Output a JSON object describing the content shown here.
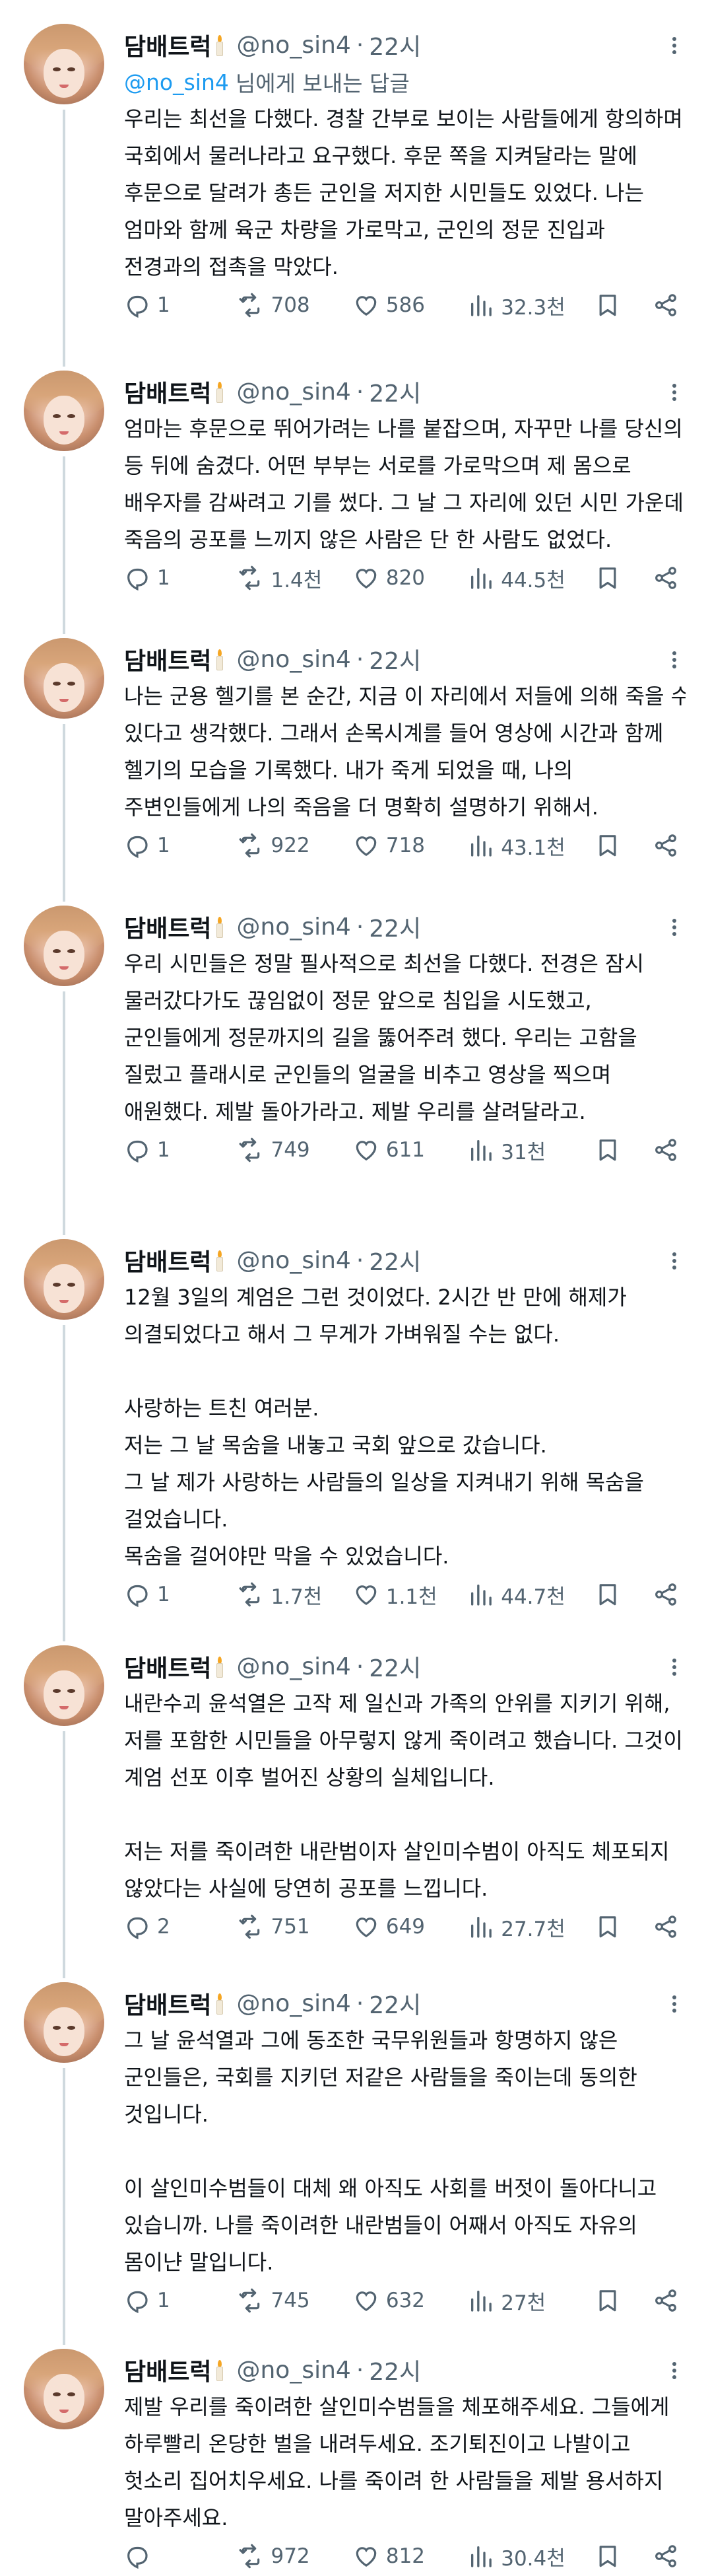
{
  "author": {
    "name": "담배트럭",
    "handle": "@no_sin4",
    "time": "22시"
  },
  "reply_prefix": {
    "mention": "@no_sin4",
    "text": "님에게 보내는 답글"
  },
  "tweets": [
    {
      "lines": [
        "우리는 최선을 다했다. 경찰 간부로 보이는 사람들에게 항의하며",
        "국회에서 물러나라고 요구했다. 후문 쪽을 지켜달라는 말에",
        "후문으로 달려가 총든 군인을 저지한 시민들도 있었다. 나는",
        "엄마와 함께 육군 차량을 가로막고, 군인의 정문 진입과",
        "전경과의 접촉을 막았다."
      ],
      "replies": "1",
      "retweets": "708",
      "likes": "586",
      "views": "32.3천"
    },
    {
      "lines": [
        "엄마는 후문으로 뛰어가려는 나를 붙잡으며, 자꾸만 나를 당신의",
        "등 뒤에 숨겼다. 어떤 부부는 서로를 가로막으며 제 몸으로",
        "배우자를 감싸려고 기를 썼다. 그 날 그 자리에 있던 시민 가운데",
        "죽음의 공포를 느끼지 않은 사람은 단 한 사람도 없었다."
      ],
      "replies": "1",
      "retweets": "1.4천",
      "likes": "820",
      "views": "44.5천"
    },
    {
      "lines": [
        "나는 군용 헬기를 본 순간, 지금 이 자리에서 저들에 의해 죽을 수",
        "있다고 생각했다. 그래서 손목시계를 들어 영상에 시간과 함께",
        "헬기의 모습을 기록했다. 내가 죽게 되었을 때, 나의",
        "주변인들에게 나의 죽음을 더 명확히 설명하기 위해서."
      ],
      "replies": "1",
      "retweets": "922",
      "likes": "718",
      "views": "43.1천"
    },
    {
      "lines": [
        "우리 시민들은 정말 필사적으로 최선을 다했다. 전경은 잠시",
        "물러갔다가도 끊임없이 정문 앞으로 침입을 시도했고,",
        "군인들에게 정문까지의 길을 뚫어주려 했다. 우리는 고함을",
        "질렀고 플래시로 군인들의 얼굴을 비추고 영상을 찍으며",
        "애원했다. 제발 돌아가라고. 제발 우리를 살려달라고."
      ],
      "replies": "1",
      "retweets": "749",
      "likes": "611",
      "views": "31천"
    },
    {
      "lines": [
        "12월 3일의 계엄은 그런 것이었다. 2시간 반 만에 해제가",
        "의결되었다고 해서 그 무게가 가벼워질 수는 없다.",
        "",
        "사랑하는 트친 여러분.",
        "저는 그 날 목숨을 내놓고 국회 앞으로 갔습니다.",
        "그 날 제가 사랑하는 사람들의 일상을 지켜내기 위해 목숨을",
        "걸었습니다.",
        "목숨을 걸어야만 막을 수 있었습니다."
      ],
      "replies": "1",
      "retweets": "1.7천",
      "likes": "1.1천",
      "views": "44.7천"
    },
    {
      "lines": [
        "내란수괴 윤석열은 고작 제 일신과 가족의 안위를 지키기 위해,",
        "저를 포함한 시민들을 아무렇지 않게 죽이려고 했습니다. 그것이",
        "계엄 선포 이후 벌어진 상황의 실체입니다.",
        "",
        "저는 저를 죽이려한 내란범이자 살인미수범이 아직도 체포되지",
        "않았다는 사실에 당연히 공포를 느낍니다."
      ],
      "replies": "2",
      "retweets": "751",
      "likes": "649",
      "views": "27.7천"
    },
    {
      "lines": [
        "그 날 윤석열과 그에 동조한 국무위원들과 항명하지 않은",
        "군인들은, 국회를 지키던 저같은 사람들을 죽이는데 동의한",
        "것입니다.",
        "",
        "이 살인미수범들이 대체 왜 아직도 사회를 버젓이 돌아다니고",
        "있습니까. 나를 죽이려한 내란범들이 어째서 아직도 자유의",
        "몸이냔 말입니다."
      ],
      "replies": "1",
      "retweets": "745",
      "likes": "632",
      "views": "27천"
    },
    {
      "lines": [
        "제발 우리를 죽이려한 살인미수범들을 체포해주세요. 그들에게",
        "하루빨리 온당한 벌을 내려두세요. 조기퇴진이고 나발이고",
        "헛소리 집어치우세요. 나를 죽이려 한 사람들을 제발 용서하지",
        "말아주세요."
      ],
      "replies": "",
      "retweets": "972",
      "likes": "812",
      "views": "30.4천"
    }
  ],
  "icons": {
    "reply": "reply-icon",
    "retweet": "retweet-icon",
    "like": "heart-icon",
    "views": "views-icon",
    "bookmark": "bookmark-icon",
    "share": "share-icon",
    "more": "more-icon"
  },
  "colors": {
    "text": "#0f1419",
    "secondary": "#536471",
    "link": "#1d9bf0",
    "thread": "#cfd9de"
  }
}
